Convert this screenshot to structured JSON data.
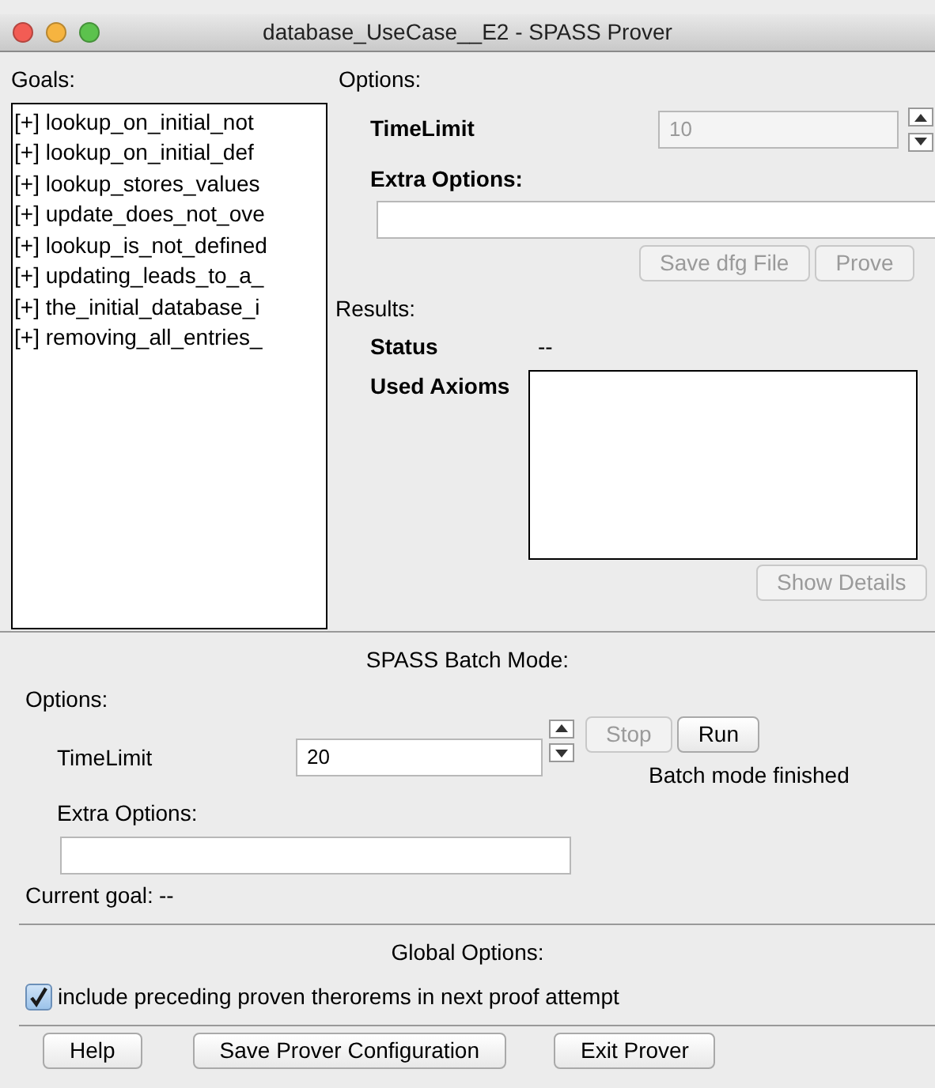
{
  "window": {
    "title": "database_UseCase__E2 - SPASS Prover"
  },
  "goals": {
    "label": "Goals:",
    "items": [
      {
        "text": "[+] lookup_on_initial_not"
      },
      {
        "text": "[+] lookup_on_initial_def"
      },
      {
        "text": "[+] lookup_stores_values"
      },
      {
        "text": "[+] update_does_not_ove"
      },
      {
        "text": "[+] lookup_is_not_defined"
      },
      {
        "text": "[+] updating_leads_to_a_"
      },
      {
        "text": "[+] the_initial_database_i"
      },
      {
        "text": "[+] removing_all_entries_"
      }
    ]
  },
  "options": {
    "label": "Options:",
    "time_limit_label": "TimeLimit",
    "time_limit_value": "10",
    "time_limit_disabled": true,
    "extra_label": "Extra Options:",
    "buttons": [
      {
        "label": "Save dfg File",
        "disabled": true
      },
      {
        "label": "Prove",
        "disabled": true
      }
    ]
  },
  "results": {
    "label": "Results:",
    "status_label": "Status",
    "status_value": "--",
    "axioms_label": "Used Axioms",
    "details_button": {
      "label": "Show Details",
      "disabled": true
    }
  },
  "batch": {
    "title": "SPASS Batch Mode:",
    "options_label": "Options:",
    "time_limit_label": "TimeLimit",
    "time_limit_value": "20",
    "extra_label": "Extra Options:",
    "buttons": [
      {
        "label": "Stop",
        "disabled": true
      },
      {
        "label": "Run",
        "disabled": false
      }
    ],
    "status": "Batch mode finished",
    "current_goal_label": "Current goal:",
    "current_goal_value": "--"
  },
  "global": {
    "title": "Global Options:",
    "checkbox": {
      "label": "include preceding proven therorems in next proof attempt",
      "checked": true
    }
  },
  "footer_buttons": [
    "Help",
    "Save Prover Configuration",
    "Exit Prover"
  ]
}
